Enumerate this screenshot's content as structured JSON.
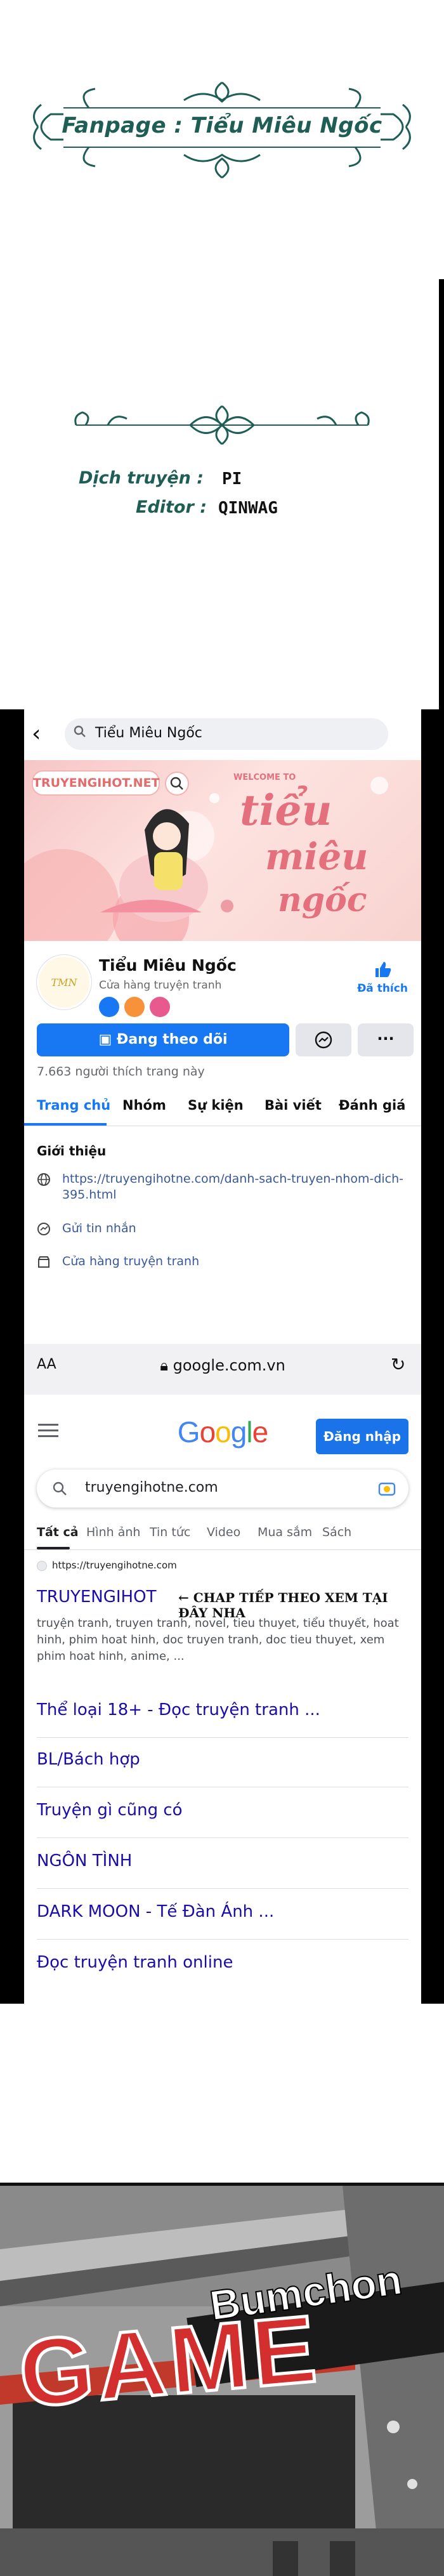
{
  "credits": {
    "fanpage": "Fanpage : Tiểu Miêu Ngốc",
    "translator_label": "Dịch truyện :",
    "translator": "PI",
    "editor_label": "Editor :",
    "editor": "QINWAG",
    "text_color": "#1f5e55"
  },
  "facebook": {
    "search_text": "Tiểu Miêu Ngốc",
    "cover": {
      "badge": "TRUYENGIHOT.NET",
      "welcome": "WELCOME TO",
      "title_lines": [
        "tiểu",
        "miêu",
        "ngốc"
      ]
    },
    "page_name": "Tiểu Miêu Ngốc",
    "category": "Cửa hàng truyện tranh",
    "liked_label": "Đã thích",
    "follow_button": "Đang theo dõi",
    "more_button": "···",
    "likes_text": "7.663 người thích trang này",
    "tabs": [
      "Trang chủ",
      "Nhóm",
      "Sự kiện",
      "Bài viết",
      "Đánh giá"
    ],
    "intro_heading": "Giới thiệu",
    "intro_items": [
      {
        "icon": "globe-icon",
        "text": "https://truyengihotne.com/danh-sach-truyen-nhom-dich-395.html"
      },
      {
        "icon": "messenger-icon",
        "text": "Gửi tin nhắn"
      },
      {
        "icon": "shop-icon",
        "text": "Cửa hàng truyện tranh"
      }
    ],
    "accent": "#1877f2"
  },
  "browser": {
    "aa": "AA",
    "url": "google.com.vn",
    "reload": "↻"
  },
  "google": {
    "logo_letters": [
      "G",
      "o",
      "o",
      "g",
      "l",
      "e"
    ],
    "logo_colors": [
      "#4285f4",
      "#ea4335",
      "#fbbc05",
      "#4285f4",
      "#34a853",
      "#ea4335"
    ],
    "signin": "Đăng nhập",
    "query": "truyengihotne.com",
    "tabs": [
      "Tất cả",
      "Hình ảnh",
      "Tin tức",
      "Video",
      "Mua sắm",
      "Sách"
    ],
    "result_site": "https://truyengihotne.com",
    "result_title": "TRUYENGIHOT",
    "result_overlay": "← CHAP TIẾP THEO XEM TẠI ĐÂY NHA",
    "result_snippet": "truyện tranh, truyen tranh, novel, tieu thuyet, tiểu thuyết, hoat hinh, phim hoat hinh, doc truyen tranh, doc tieu thuyet, xem phim hoat hinh, anime, ...",
    "sitelinks": [
      "Thể loại 18+ - Đọc truyện tranh ...",
      "BL/Bách hợp",
      "Truyện gì cũng có",
      "NGÔN TÌNH",
      "DARK MOON - Tế Đàn Ánh ...",
      "Đọc truyện tranh online"
    ]
  },
  "comic": {
    "sign_top": "Bumchon",
    "sign_main": "GAME"
  }
}
